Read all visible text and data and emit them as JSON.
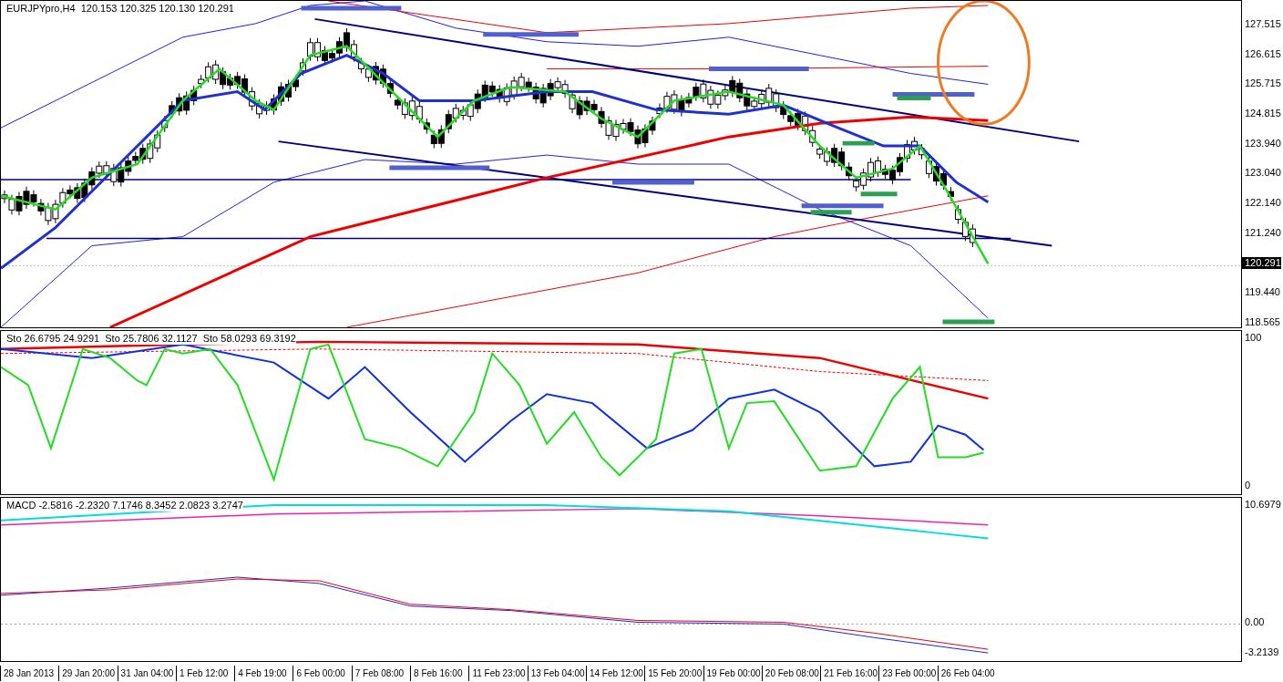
{
  "main_chart": {
    "header": "EURJPYpro,H4  120.153 120.325 120.130 120.291",
    "price_axis": [
      {
        "label": "127.515",
        "kind": "tick"
      },
      {
        "label": "126.615",
        "kind": "tick"
      },
      {
        "label": "125.715",
        "kind": "tick"
      },
      {
        "label": "124.815",
        "kind": "tick"
      },
      {
        "label": "123.940",
        "kind": "tick"
      },
      {
        "label": "123.040",
        "kind": "tick"
      },
      {
        "label": "122.140",
        "kind": "tick"
      },
      {
        "label": "121.240",
        "kind": "tick"
      },
      {
        "label": "120.291",
        "kind": "current"
      },
      {
        "label": "119.440",
        "kind": "tick"
      },
      {
        "label": "118.565",
        "kind": "tick"
      }
    ]
  },
  "stochastic": {
    "header": "Sto 26.6795 24.9291  Sto 25.7806 32.1127  Sto 58.0293 69.3192",
    "axis": [
      {
        "label": "100",
        "kind": "max"
      },
      {
        "label": "0",
        "kind": "min"
      }
    ]
  },
  "macd": {
    "header": "MACD -2.5816 -2.2320 7.1746 8.3452 2.0823 3.2747",
    "axis": [
      {
        "label": "10.6979",
        "kind": "max"
      },
      {
        "label": "0.00",
        "kind": "zero"
      },
      {
        "label": "-3.2139",
        "kind": "min"
      }
    ]
  },
  "time_axis": [
    "28 Jan 2013",
    "29 Jan 20:00",
    "31 Jan 04:00",
    "1 Feb 12:00",
    "4 Feb 19:00",
    "6 Feb 00:00",
    "7 Feb 08:00",
    "8 Feb 16:00",
    "11 Feb 23:00",
    "13 Feb 04:00",
    "14 Feb 12:00",
    "15 Feb 20:00",
    "19 Feb 00:00",
    "20 Feb 08:00",
    "21 Feb 16:00",
    "23 Feb 00:00",
    "26 Feb 04:00"
  ]
}
